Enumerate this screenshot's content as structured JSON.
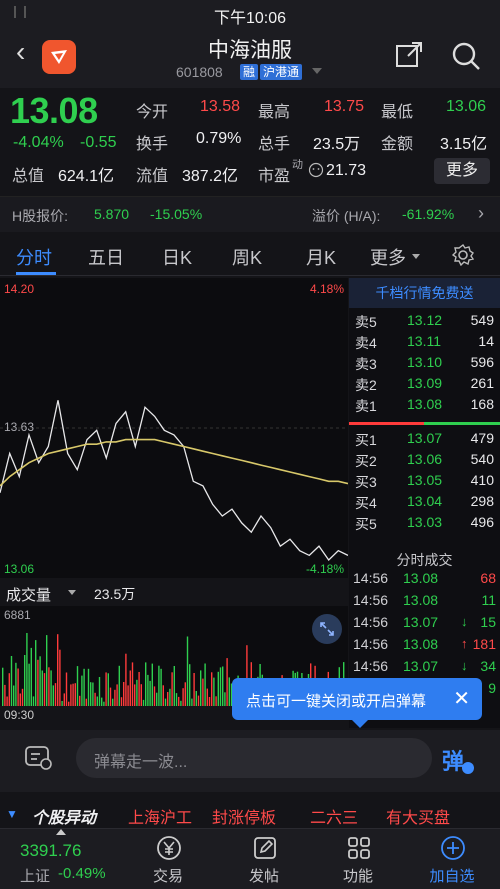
{
  "status": {
    "time": "下午10:06"
  },
  "header": {
    "title": "中海油服",
    "code": "601808",
    "tag1": "融",
    "tag2": "沪港通"
  },
  "quote": {
    "price": "13.08",
    "change_pct": "-4.04%",
    "change": "-0.55",
    "open_label": "今开",
    "open": "13.58",
    "high_label": "最高",
    "high": "13.75",
    "low_label": "最低",
    "low": "13.06",
    "turnover_label": "换手",
    "turnover": "0.79%",
    "volume_label": "总手",
    "volume": "23.5万",
    "amount_label": "金额",
    "amount": "3.15亿",
    "mktcap_label": "总值",
    "mktcap": "624.1亿",
    "float_label": "流值",
    "float": "387.2亿",
    "pe_label": "市盈",
    "pe_sup": "动",
    "pe": "21.73",
    "more_label": "更多"
  },
  "hshare": {
    "label": "H股报价:",
    "price": "5.870",
    "pct": "-15.05%",
    "premium_label": "溢价 (H/A):",
    "premium": "-61.92%"
  },
  "tabs": [
    "分时",
    "五日",
    "日K",
    "周K",
    "月K",
    "更多"
  ],
  "chart": {
    "top_left": "14.20",
    "top_right": "4.18%",
    "mid_left": "13.63",
    "bottom_left": "13.06",
    "bottom_right": "-4.18%"
  },
  "chart_data": {
    "type": "line",
    "title": "",
    "series": [
      {
        "values": [
          13.35,
          13.52,
          13.42,
          13.6,
          13.48,
          13.55,
          13.75,
          13.52,
          13.45,
          13.58,
          13.62,
          13.5,
          13.65,
          13.7,
          13.55,
          13.72,
          13.68,
          13.62,
          13.6,
          13.55,
          13.4,
          13.38,
          13.3,
          13.25,
          13.28,
          13.22,
          13.18,
          13.25,
          13.2,
          13.12,
          13.15,
          13.1,
          13.08,
          13.12,
          13.06,
          13.1,
          13.08
        ]
      },
      {
        "values": [
          13.38,
          13.42,
          13.45,
          13.48,
          13.5,
          13.52,
          13.53,
          13.54,
          13.55,
          13.56,
          13.56,
          13.57,
          13.57,
          13.58,
          13.58,
          13.58,
          13.58,
          13.57,
          13.56,
          13.55,
          13.54,
          13.53,
          13.52,
          13.51,
          13.5,
          13.49,
          13.48,
          13.47,
          13.46,
          13.45,
          13.44,
          13.43,
          13.42,
          13.41,
          13.4,
          13.4,
          13.39
        ]
      }
    ],
    "ylim": [
      13.06,
      14.2
    ]
  },
  "orderbook": {
    "header": "千档行情免费送",
    "asks": [
      {
        "label": "卖5",
        "price": "13.12",
        "vol": "549"
      },
      {
        "label": "卖4",
        "price": "13.11",
        "vol": "14"
      },
      {
        "label": "卖3",
        "price": "13.10",
        "vol": "596"
      },
      {
        "label": "卖2",
        "price": "13.09",
        "vol": "261"
      },
      {
        "label": "卖1",
        "price": "13.08",
        "vol": "168"
      }
    ],
    "bids": [
      {
        "label": "买1",
        "price": "13.07",
        "vol": "479"
      },
      {
        "label": "买2",
        "price": "13.06",
        "vol": "540"
      },
      {
        "label": "买3",
        "price": "13.05",
        "vol": "410"
      },
      {
        "label": "买4",
        "price": "13.04",
        "vol": "298"
      },
      {
        "label": "买5",
        "price": "13.03",
        "vol": "496"
      }
    ],
    "trades_header": "分时成交",
    "trades": [
      {
        "time": "14:56",
        "price": "13.08",
        "arrow": "",
        "vol": "68"
      },
      {
        "time": "14:56",
        "price": "13.08",
        "arrow": "",
        "vol": "11"
      },
      {
        "time": "14:56",
        "price": "13.07",
        "arrow": "↓",
        "vol": "15"
      },
      {
        "time": "14:56",
        "price": "13.08",
        "arrow": "↑",
        "vol": "181"
      },
      {
        "time": "14:56",
        "price": "13.07",
        "arrow": "↓",
        "vol": "34"
      },
      {
        "time": "14:56",
        "price": "",
        "arrow": "",
        "vol": "9"
      }
    ]
  },
  "volume": {
    "select": "成交量",
    "value": "23.5万",
    "scale": "6881",
    "start_time": "09:30"
  },
  "toast": {
    "text": "点击可一键关闭或开启弹幕"
  },
  "danmu": {
    "placeholder": "弹幕走一波...",
    "button": "弹"
  },
  "ticker": {
    "items": [
      "个股异动",
      "上海沪工",
      "封涨停板",
      "二六三",
      "有大买盘"
    ]
  },
  "bottom": {
    "index_value": "3391.76",
    "index_label": "上证",
    "index_pct": "-0.49%",
    "items": [
      "交易",
      "发帖",
      "功能",
      "加自选"
    ]
  }
}
